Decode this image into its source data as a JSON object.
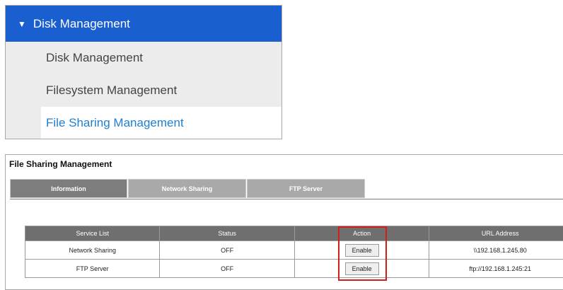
{
  "sidebar": {
    "header": {
      "label": "Disk Management",
      "expand_icon": "triangle-down"
    },
    "items": [
      {
        "label": "Disk Management"
      },
      {
        "label": "Filesystem Management"
      },
      {
        "label": "File Sharing Management",
        "active": true
      }
    ],
    "colors": {
      "header_bg": "#1a5fd0",
      "active_text": "#1e7fd0"
    }
  },
  "file_sharing": {
    "title": "File Sharing Management",
    "tabs": [
      {
        "label": "Information",
        "active": true
      },
      {
        "label": "Network Sharing"
      },
      {
        "label": "FTP Server"
      }
    ],
    "table": {
      "headers": [
        "Service List",
        "Status",
        "Action",
        "URL Address"
      ],
      "rows": [
        {
          "service": "Network Sharing",
          "status": "OFF",
          "action": "Enable",
          "url": "\\\\192.168.1.245.80"
        },
        {
          "service": "FTP Server",
          "status": "OFF",
          "action": "Enable",
          "url": "ftp://192.168.1.245:21"
        }
      ]
    },
    "highlight_color": "#d21e1e"
  }
}
